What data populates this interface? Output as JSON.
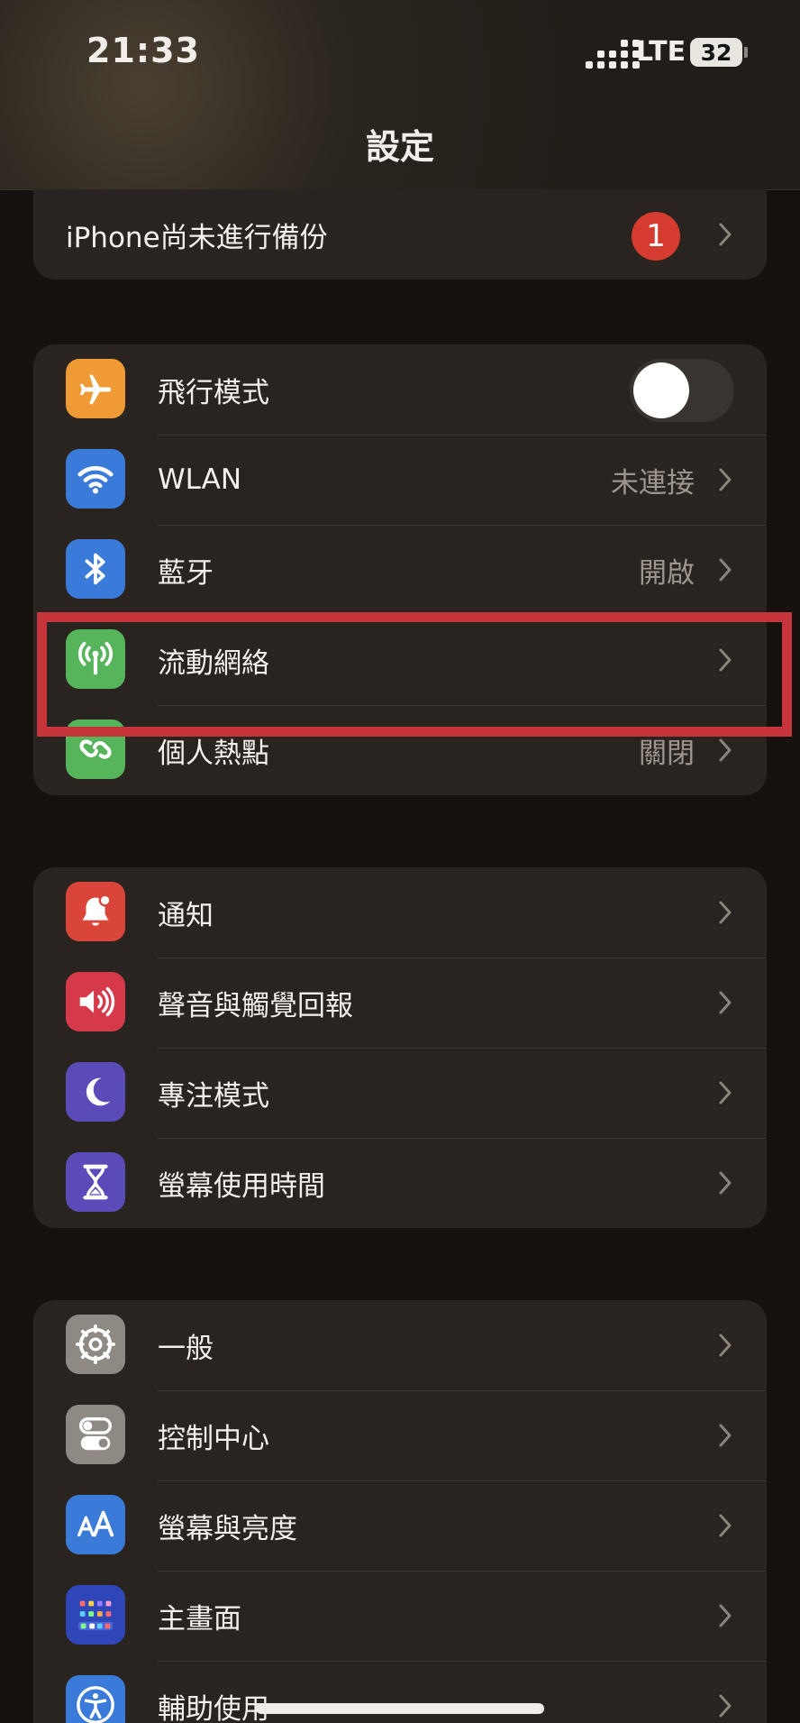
{
  "status_bar": {
    "time": "21:33",
    "network": "LTE",
    "battery": "32"
  },
  "header": {
    "title": "設定"
  },
  "backup": {
    "label": "iPhone尚未進行備份",
    "badge": "1"
  },
  "connectivity": [
    {
      "label": "飛行模式",
      "value": "",
      "icon": "airplane-icon",
      "color": "#ef9a35",
      "toggle": false
    },
    {
      "label": "WLAN",
      "value": "未連接",
      "icon": "wifi-icon",
      "color": "#3a7ad8"
    },
    {
      "label": "藍牙",
      "value": "開啟",
      "icon": "bluetooth-icon",
      "color": "#3a7ad8"
    },
    {
      "label": "流動網絡",
      "value": "",
      "icon": "antenna-icon",
      "color": "#56b45a"
    },
    {
      "label": "個人熱點",
      "value": "關閉",
      "icon": "link-icon",
      "color": "#56b45a"
    }
  ],
  "notifications": [
    {
      "label": "通知",
      "icon": "bell-icon",
      "color": "#d94639"
    },
    {
      "label": "聲音與觸覺回報",
      "icon": "speaker-icon",
      "color": "#d63a4a"
    },
    {
      "label": "專注模式",
      "icon": "moon-icon",
      "color": "#5b4bb8"
    },
    {
      "label": "螢幕使用時間",
      "icon": "hourglass-icon",
      "color": "#5b4bb8"
    }
  ],
  "general": [
    {
      "label": "一般",
      "icon": "gear-icon",
      "color": "#8e8983"
    },
    {
      "label": "控制中心",
      "icon": "switches-icon",
      "color": "#8e8983"
    },
    {
      "label": "螢幕與亮度",
      "icon": "text-size-icon",
      "color": "#3a7ad8"
    },
    {
      "label": "主畫面",
      "icon": "home-grid-icon",
      "color": "#2f46b8"
    },
    {
      "label": "輔助使用",
      "icon": "accessibility-icon",
      "color": "#3a7ad8"
    }
  ]
}
